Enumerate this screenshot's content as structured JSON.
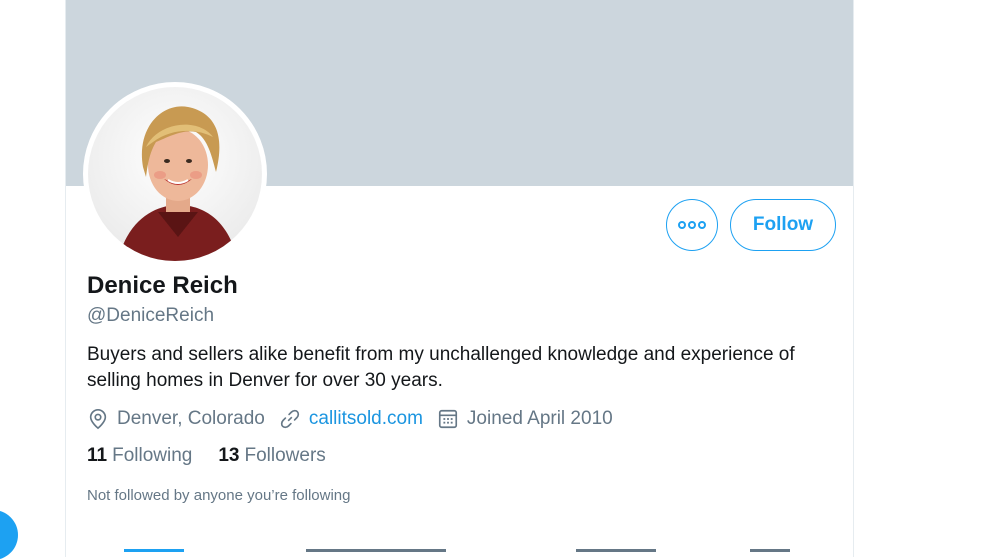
{
  "profile": {
    "name": "Denice Reich",
    "handle": "@DeniceReich",
    "bio": "Buyers and sellers alike benefit from my unchallenged knowledge and experience of selling homes in Denver for over 30 years.",
    "location": "Denver, Colorado",
    "website": "callitsold.com",
    "joined": "Joined April 2010",
    "following_count": "11",
    "following_label": "Following",
    "followers_count": "13",
    "followers_label": "Followers",
    "not_followed_text": "Not followed by anyone you’re following"
  },
  "actions": {
    "follow_label": "Follow",
    "more_icon": "more-icon"
  },
  "icons": {
    "location": "location-pin-icon",
    "link": "link-icon",
    "calendar": "calendar-icon"
  },
  "colors": {
    "accent": "#1da1f2",
    "banner": "#ccd6dd",
    "secondary_text": "#657786"
  }
}
